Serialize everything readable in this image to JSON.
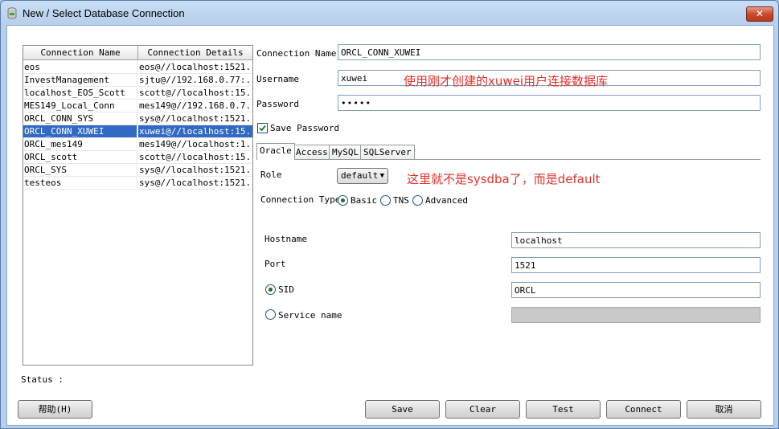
{
  "window": {
    "title": "New / Select Database Connection",
    "close_label": "✕"
  },
  "table": {
    "headers": [
      "Connection Name",
      "Connection Details"
    ],
    "rows": [
      {
        "name": "eos",
        "details": "eos@//localhost:1521..."
      },
      {
        "name": "InvestManagement",
        "details": "sjtu@//192.168.0.77:..."
      },
      {
        "name": "localhost_EOS_Scott",
        "details": "scott@//localhost:15..."
      },
      {
        "name": "MES149_Local_Conn",
        "details": "mes149@//192.168.0.7..."
      },
      {
        "name": "ORCL_CONN_SYS",
        "details": "sys@//localhost:1521..."
      },
      {
        "name": "ORCL_CONN_XUWEI",
        "details": "xuwei@//localhost:15..."
      },
      {
        "name": "ORCL_mes149",
        "details": "mes149@//localhost:1..."
      },
      {
        "name": "ORCL_scott",
        "details": "scott@//localhost:15..."
      },
      {
        "name": "ORCL_SYS",
        "details": "sys@//localhost:1521..."
      },
      {
        "name": "testeos",
        "details": "sys@//localhost:1521..."
      }
    ],
    "selected_index": 5
  },
  "form": {
    "conn_name_label": "Connection Name",
    "conn_name_value": "ORCL_CONN_XUWEI",
    "username_label": "Username",
    "username_value": "xuwei",
    "password_label": "Password",
    "password_value": "•••••",
    "save_password_label": "Save Password",
    "save_password_checked": true
  },
  "annotations": {
    "username_note": "使用刚才创建的xuwei用户连接数据库",
    "role_note": "这里就不是sysdba了，而是default"
  },
  "tabs": [
    "Oracle",
    "Access",
    "MySQL",
    "SQLServer"
  ],
  "oracle": {
    "role_label": "Role",
    "role_value": "default",
    "conn_type_label": "Connection Type",
    "conn_types": [
      "Basic",
      "TNS",
      "Advanced"
    ],
    "conn_type_selected": "Basic",
    "hostname_label": "Hostname",
    "hostname_value": "localhost",
    "port_label": "Port",
    "port_value": "1521",
    "sid_label": "SID",
    "sid_value": "ORCL",
    "service_label": "Service name",
    "service_value": ""
  },
  "status": {
    "label": "Status :"
  },
  "buttons": {
    "help": "帮助(H)",
    "save": "Save",
    "clear": "Clear",
    "test": "Test",
    "connect": "Connect",
    "cancel": "取消"
  },
  "colors": {
    "selection": "#316ac5",
    "annotation": "#e0302a",
    "close": "#c84a2f"
  }
}
